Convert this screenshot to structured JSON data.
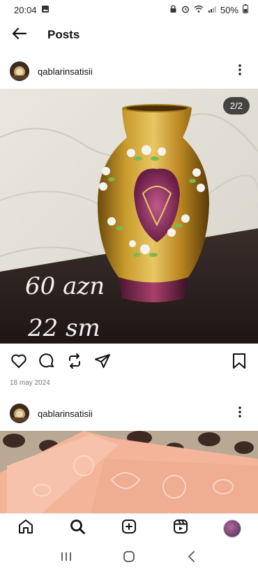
{
  "status_bar": {
    "time": "20:04",
    "battery": "50%"
  },
  "header": {
    "title": "Posts",
    "back_icon": "arrow-left-icon"
  },
  "posts": [
    {
      "username": "qablarinsatisii",
      "image_counter": "2/2",
      "image_overlay_price": "60 azn",
      "image_overlay_size": "22 sm",
      "date": "18 may 2024",
      "image_subject": "gold-and-purple-painted-vase"
    },
    {
      "username": "qablarinsatisii",
      "image_subject": "peach-embossed-towels"
    }
  ],
  "bottom_nav": [
    "home-icon",
    "search-icon",
    "create-icon",
    "reels-icon",
    "profile-avatar"
  ],
  "system_nav": [
    "recents-icon",
    "home-circle-icon",
    "back-chevron-icon"
  ],
  "colors": {
    "accent": "#000000",
    "badge_bg": "#2a2a2a",
    "date_text": "#777777"
  }
}
